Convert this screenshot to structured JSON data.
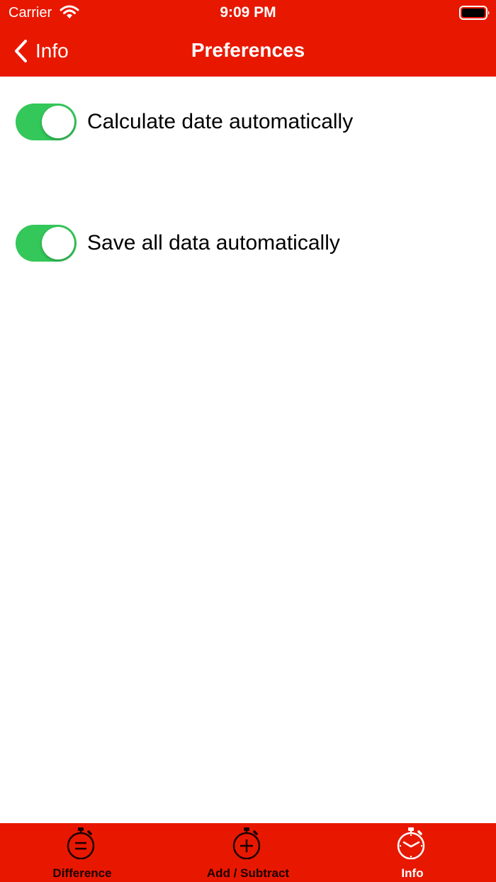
{
  "status_bar": {
    "carrier": "Carrier",
    "time": "9:09 PM",
    "wifi_icon": "wifi-icon",
    "battery_icon": "battery-icon"
  },
  "nav": {
    "back_label": "Info",
    "back_icon": "chevron-left-icon",
    "title": "Preferences"
  },
  "preferences": [
    {
      "label": "Calculate date automatically",
      "enabled": true
    },
    {
      "label": "Save all data automatically",
      "enabled": true
    }
  ],
  "tab_bar": {
    "items": [
      {
        "label": "Difference",
        "icon": "stopwatch-equals-icon",
        "active": false
      },
      {
        "label": "Add / Subtract",
        "icon": "stopwatch-plus-icon",
        "active": false
      },
      {
        "label": "Info",
        "icon": "stopwatch-clock-icon",
        "active": true
      }
    ]
  },
  "colors": {
    "brand_red": "#e81800",
    "toggle_on": "#34c759",
    "inactive_tab": "#1a0000",
    "active_tab": "#ffffff"
  }
}
